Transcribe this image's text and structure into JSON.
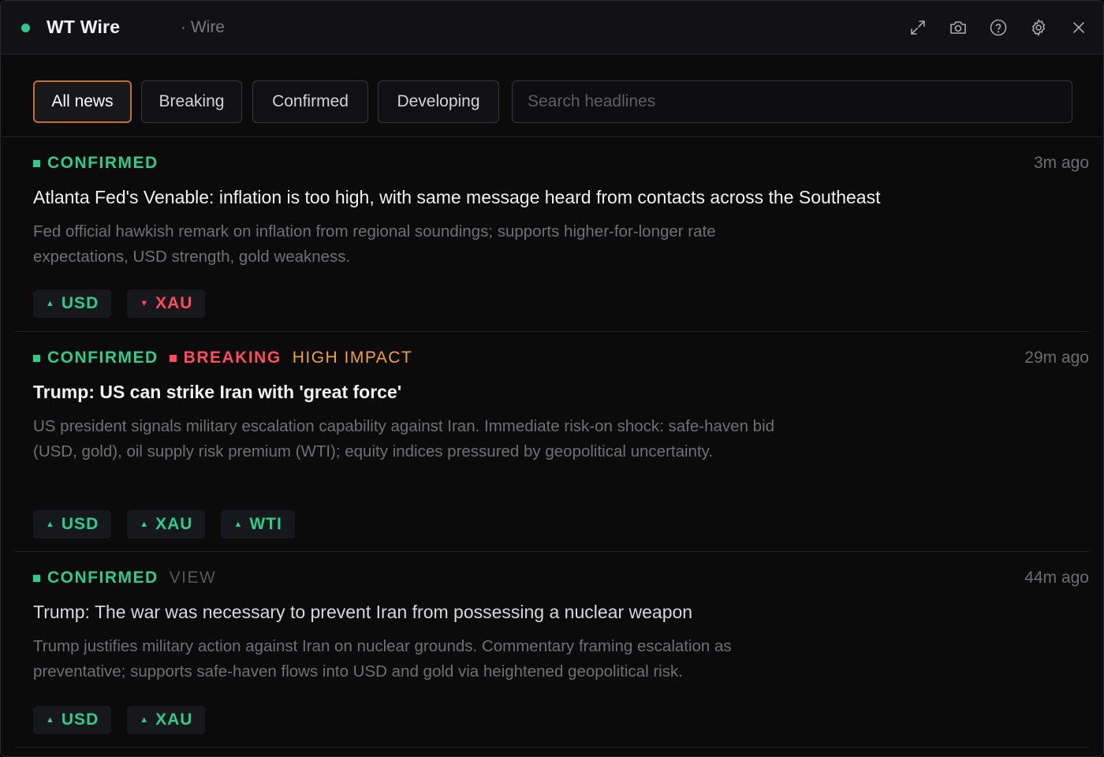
{
  "window": {
    "title": "WT Wire",
    "subtitle": "· Wire"
  },
  "icons": {
    "status": "status-dot",
    "expand": "expand-icon",
    "screenshot": "camera-icon",
    "help": "help-icon",
    "settings": "gear-icon",
    "close": "close-icon"
  },
  "filters": {
    "all": "All news",
    "breaking": "Breaking",
    "confirmed": "Confirmed",
    "developing": "Developing",
    "active": "All news"
  },
  "search": {
    "placeholder": "Search headlines",
    "value": ""
  },
  "colors": {
    "accent": "#c66a3a",
    "confirmed": "#2ecc8a",
    "breaking": "#ff4b5c",
    "impact": "#f0a23a",
    "up": "#2ecc8a",
    "down": "#ff4b5c"
  },
  "news": [
    {
      "tags": {
        "confirmed": "CONFIRMED"
      },
      "time": "3m ago",
      "headline": "Atlanta Fed's Venable: inflation is too high, with same message heard from contacts across the Southeast",
      "summary": "Fed official hawkish remark on inflation from regional soundings; supports higher-for-longer rate expectations, USD strength, gold weakness.",
      "assets": [
        {
          "symbol": "USD",
          "direction": "up",
          "arrow": "▲"
        },
        {
          "symbol": "XAU",
          "direction": "down",
          "arrow": "▼"
        }
      ]
    },
    {
      "tags": {
        "confirmed": "CONFIRMED",
        "breaking": "BREAKING",
        "impact": "HIGH IMPACT"
      },
      "time": "29m ago",
      "headline": "Trump: US can strike Iran with 'great force'",
      "summary": "US president signals military escalation capability against Iran. Immediate risk-on shock: safe-haven bid (USD, gold), oil supply risk premium (WTI); equity indices pressured by geopolitical uncertainty.",
      "assets": [
        {
          "symbol": "USD",
          "direction": "up",
          "arrow": "▲"
        },
        {
          "symbol": "XAU",
          "direction": "up",
          "arrow": "▲"
        },
        {
          "symbol": "WTI",
          "direction": "up",
          "arrow": "▲"
        }
      ]
    },
    {
      "tags": {
        "confirmed": "CONFIRMED",
        "view": "VIEW"
      },
      "time": "44m ago",
      "headline": "Trump: The war was necessary to prevent Iran from possessing a nuclear weapon",
      "summary": "Trump justifies military action against Iran on nuclear grounds. Commentary framing escalation as preventative; supports safe-haven flows into USD and gold via heightened geopolitical risk.",
      "assets": [
        {
          "symbol": "USD",
          "direction": "up",
          "arrow": "▲"
        },
        {
          "symbol": "XAU",
          "direction": "up",
          "arrow": "▲"
        }
      ]
    }
  ]
}
